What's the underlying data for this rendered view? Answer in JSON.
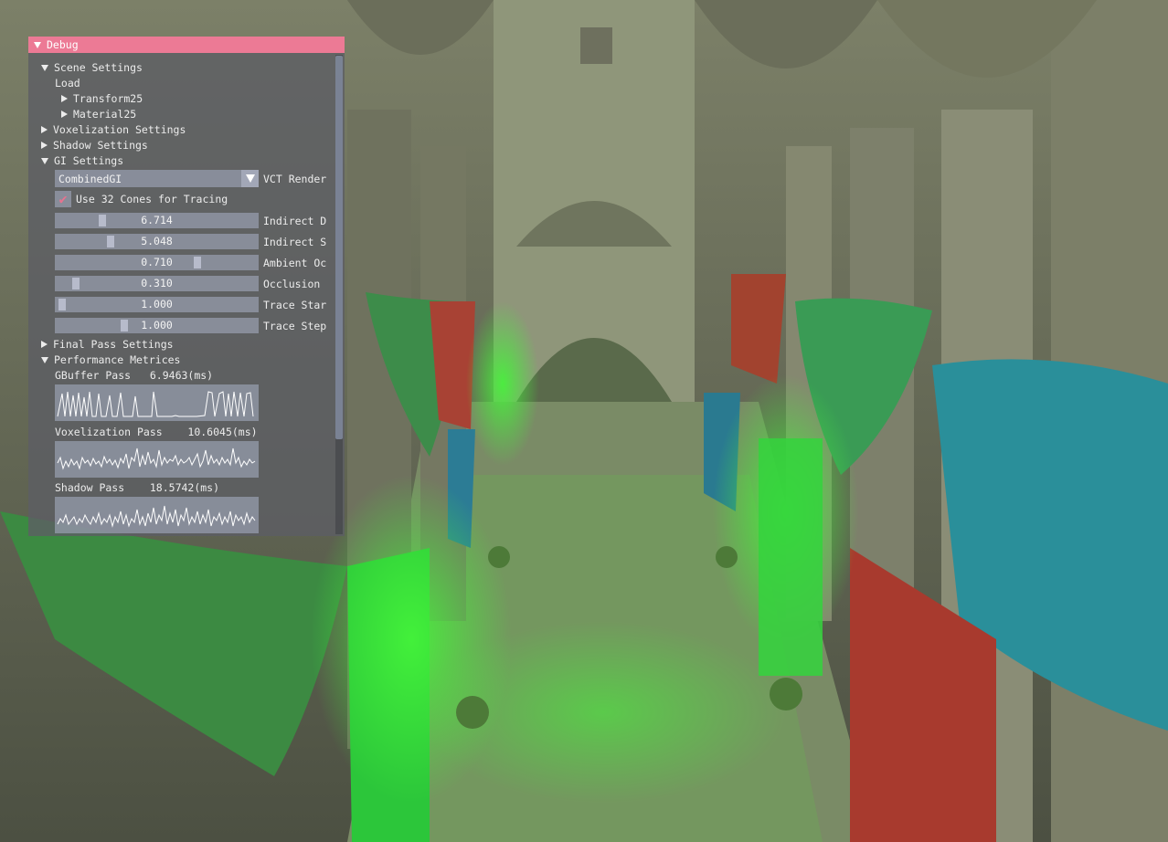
{
  "window": {
    "title": "Debug"
  },
  "scene_settings": {
    "label": "Scene Settings",
    "load_label": "Load",
    "children": [
      "Transform25",
      "Material25"
    ]
  },
  "voxelization_settings": {
    "label": "Voxelization Settings"
  },
  "shadow_settings": {
    "label": "Shadow Settings"
  },
  "gi_settings": {
    "label": "GI Settings",
    "combo": {
      "value": "CombinedGI",
      "label": "VCT Render"
    },
    "checkbox": {
      "label": "Use 32 Cones for Tracing",
      "checked": true
    },
    "sliders": [
      {
        "value": "6.714",
        "label": "Indirect D",
        "fraction": 0.22
      },
      {
        "value": "5.048",
        "label": "Indirect S",
        "fraction": 0.26
      },
      {
        "value": "0.710",
        "label": "Ambient Oc",
        "fraction": 0.71
      },
      {
        "value": "0.310",
        "label": "Occlusion ",
        "fraction": 0.08
      },
      {
        "value": "1.000",
        "label": "Trace Star",
        "fraction": 0.01
      },
      {
        "value": "1.000",
        "label": "Trace Step",
        "fraction": 0.33
      }
    ]
  },
  "final_pass_settings": {
    "label": "Final Pass Settings"
  },
  "performance": {
    "label": "Performance Metrices",
    "passes": [
      {
        "label": "GBuffer Pass",
        "time": "6.9463(ms)"
      },
      {
        "label": "Voxelization Pass",
        "time": "10.6045(ms)"
      },
      {
        "label": "Shadow Pass",
        "time": "18.5742(ms)"
      }
    ]
  },
  "colors": {
    "titlebar": "#ec7a95",
    "checkmark": "#e7738f",
    "panel": "#5c5e64"
  }
}
